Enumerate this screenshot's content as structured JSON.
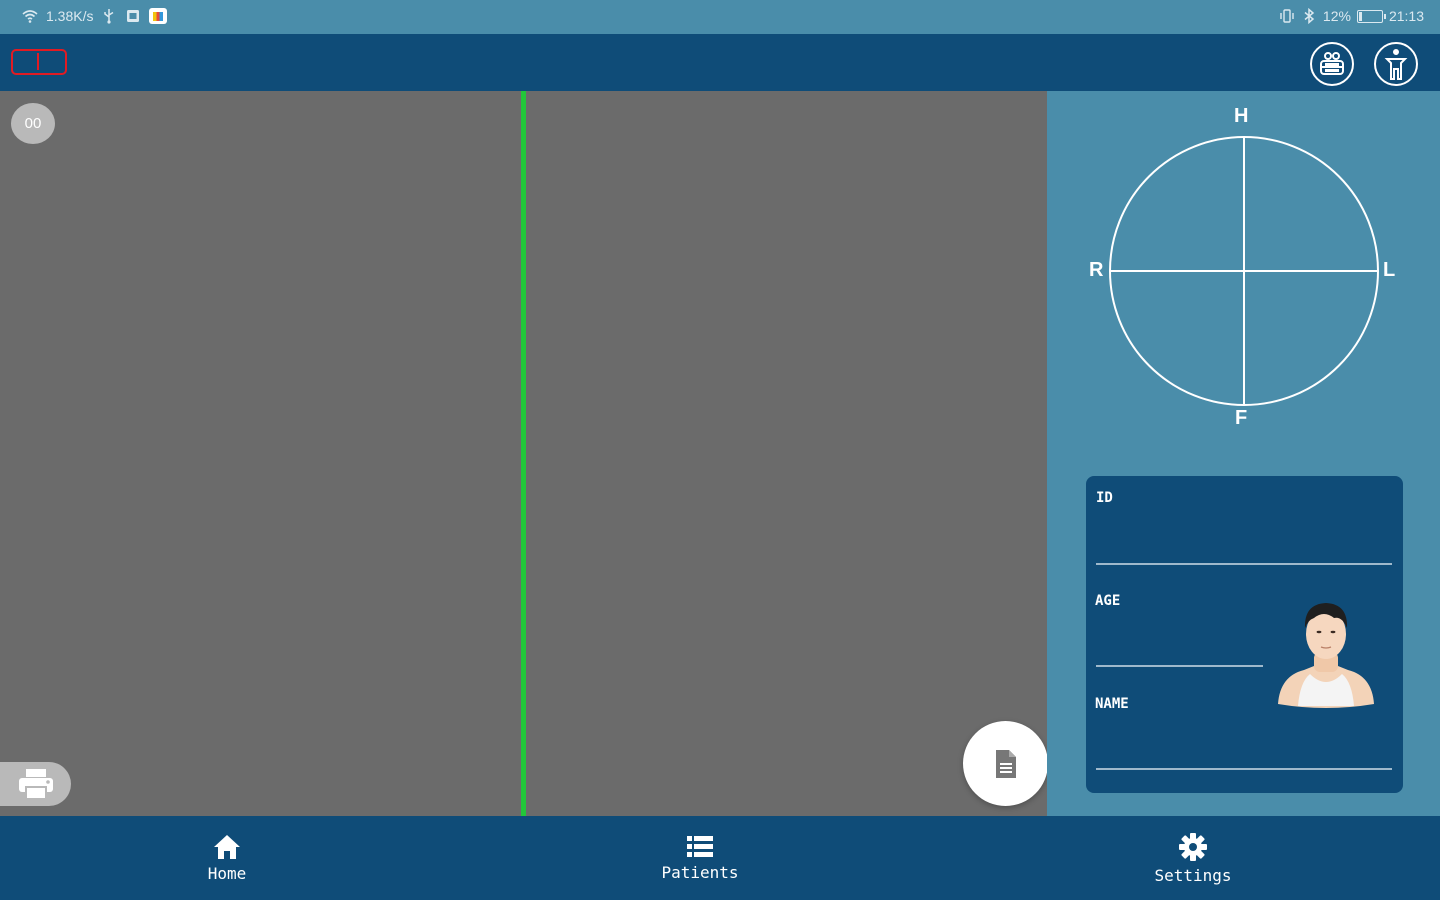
{
  "status_bar": {
    "network_speed": "1.38K/s",
    "battery_percent": "12%",
    "time": "21:13",
    "battery_level": 0.12,
    "icons": [
      "wifi-icon",
      "usb-icon",
      "sim-icon",
      "app-icon",
      "vibrate-icon",
      "bluetooth-icon",
      "battery-icon"
    ]
  },
  "top_bar": {
    "device_indicator": "battery-device-icon",
    "icons": [
      "lead-placement-icon",
      "body-view-icon"
    ]
  },
  "ecg": {
    "counter": "00",
    "print_icon": "print-icon",
    "report_icon": "report-icon"
  },
  "axis": {
    "top": "H",
    "right": "L",
    "bottom": "F",
    "left": "R"
  },
  "patient": {
    "id_label": "ID",
    "age_label": "AGE",
    "name_label": "NAME",
    "id_value": "",
    "age_value": "",
    "name_value": "",
    "avatar": "patient-avatar"
  },
  "nav": {
    "home": "Home",
    "patients": "Patients",
    "settings": "Settings"
  },
  "colors": {
    "primary": "#0f4c78",
    "panel": "#4a8daa",
    "ecg_bg": "#6b6b6b",
    "divider": "#22c73a",
    "indicator": "#e21b23"
  }
}
